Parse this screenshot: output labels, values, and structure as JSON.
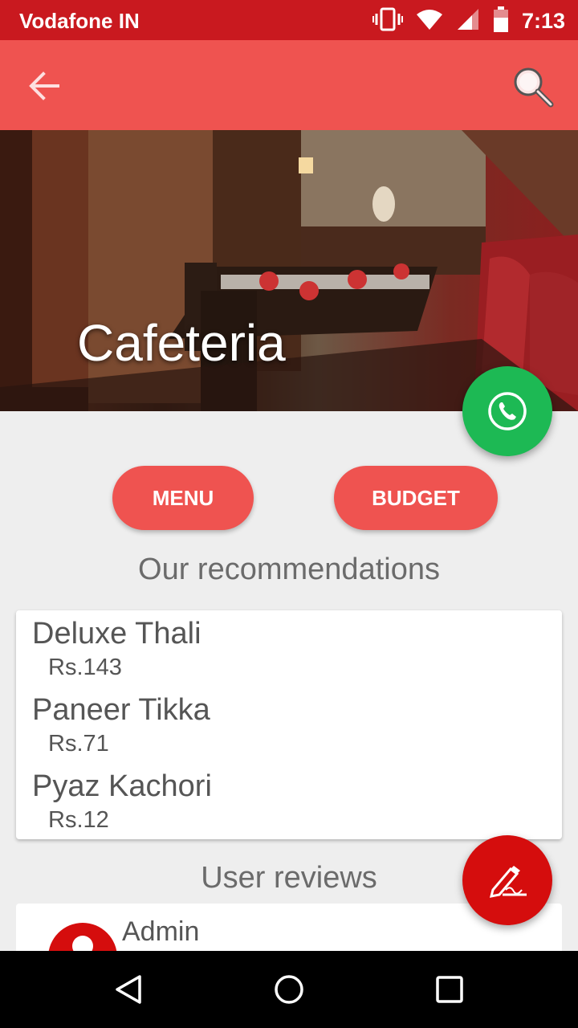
{
  "status_bar": {
    "carrier": "Vodafone IN",
    "time": "7:13",
    "icons": [
      "vibrate-icon",
      "wifi-icon",
      "signal-icon",
      "battery-icon"
    ]
  },
  "toolbar": {
    "back_icon": "arrow-left-icon",
    "search_icon": "search-icon"
  },
  "hero": {
    "title": "Cafeteria"
  },
  "actions": {
    "menu_label": "MENU",
    "budget_label": "BUDGET"
  },
  "recommendations": {
    "title": "Our recommendations",
    "items": [
      {
        "name": "Deluxe Thali",
        "price": "Rs.143"
      },
      {
        "name": "Paneer Tikka",
        "price": "Rs.71"
      },
      {
        "name": "Pyaz Kachori",
        "price": "Rs.12"
      }
    ]
  },
  "reviews": {
    "title": "User reviews",
    "items": [
      {
        "user": "Admin"
      }
    ]
  },
  "colors": {
    "status_bar": "#c9191f",
    "toolbar": "#ef5350",
    "accent": "#ef5350",
    "call_fab": "#1db954",
    "edit_fab": "#d50d0d"
  }
}
